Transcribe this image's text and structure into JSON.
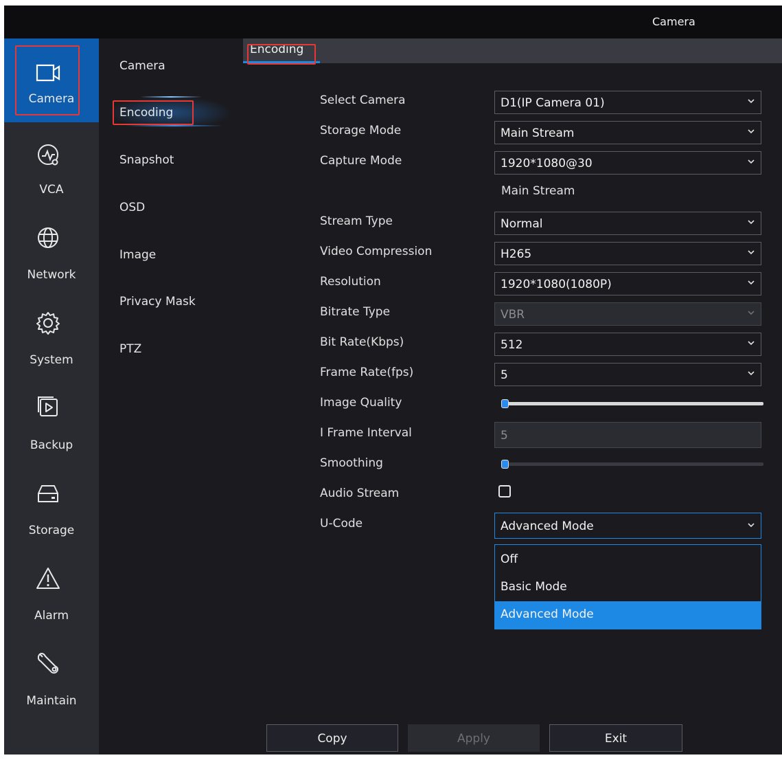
{
  "window": {
    "title": "Camera"
  },
  "left_nav": [
    {
      "label": "Camera",
      "icon": "camera-icon",
      "active": true
    },
    {
      "label": "VCA",
      "icon": "vca-icon"
    },
    {
      "label": "Network",
      "icon": "globe-icon"
    },
    {
      "label": "System",
      "icon": "gear-icon"
    },
    {
      "label": "Backup",
      "icon": "backup-icon"
    },
    {
      "label": "Storage",
      "icon": "hdd-icon"
    },
    {
      "label": "Alarm",
      "icon": "alarm-icon"
    },
    {
      "label": "Maintain",
      "icon": "wrench-icon"
    }
  ],
  "sub_nav": [
    {
      "label": "Camera"
    },
    {
      "label": "Encoding",
      "active": true
    },
    {
      "label": "Snapshot"
    },
    {
      "label": "OSD"
    },
    {
      "label": "Image"
    },
    {
      "label": "Privacy Mask"
    },
    {
      "label": "PTZ"
    }
  ],
  "tab": {
    "label": "Encoding"
  },
  "form": {
    "select_camera": {
      "label": "Select Camera",
      "value": "D1(IP Camera 01)"
    },
    "storage_mode": {
      "label": "Storage Mode",
      "value": "Main Stream"
    },
    "capture_mode": {
      "label": "Capture Mode",
      "value": "1920*1080@30"
    },
    "section_heading": "Main Stream",
    "stream_type": {
      "label": "Stream Type",
      "value": "Normal"
    },
    "video_compression": {
      "label": "Video Compression",
      "value": "H265"
    },
    "resolution": {
      "label": "Resolution",
      "value": "1920*1080(1080P)"
    },
    "bitrate_type": {
      "label": "Bitrate Type",
      "value": "VBR"
    },
    "bit_rate": {
      "label": "Bit Rate(Kbps)",
      "value": "512"
    },
    "frame_rate": {
      "label": "Frame Rate(fps)",
      "value": "5"
    },
    "image_quality": {
      "label": "Image Quality",
      "level": 0
    },
    "i_frame_interval": {
      "label": "I Frame Interval",
      "value": "5"
    },
    "smoothing": {
      "label": "Smoothing",
      "level": 0
    },
    "audio_stream": {
      "label": "Audio Stream",
      "checked": false
    },
    "u_code": {
      "label": "U-Code",
      "value": "Advanced Mode",
      "options": [
        "Off",
        "Basic Mode",
        "Advanced Mode"
      ],
      "selected_option": "Advanced Mode"
    }
  },
  "buttons": {
    "copy": "Copy",
    "apply": "Apply",
    "exit": "Exit"
  },
  "colors": {
    "accent": "#1e88e5",
    "nav_active": "#0e5cae",
    "highlight_box": "#e53935"
  }
}
